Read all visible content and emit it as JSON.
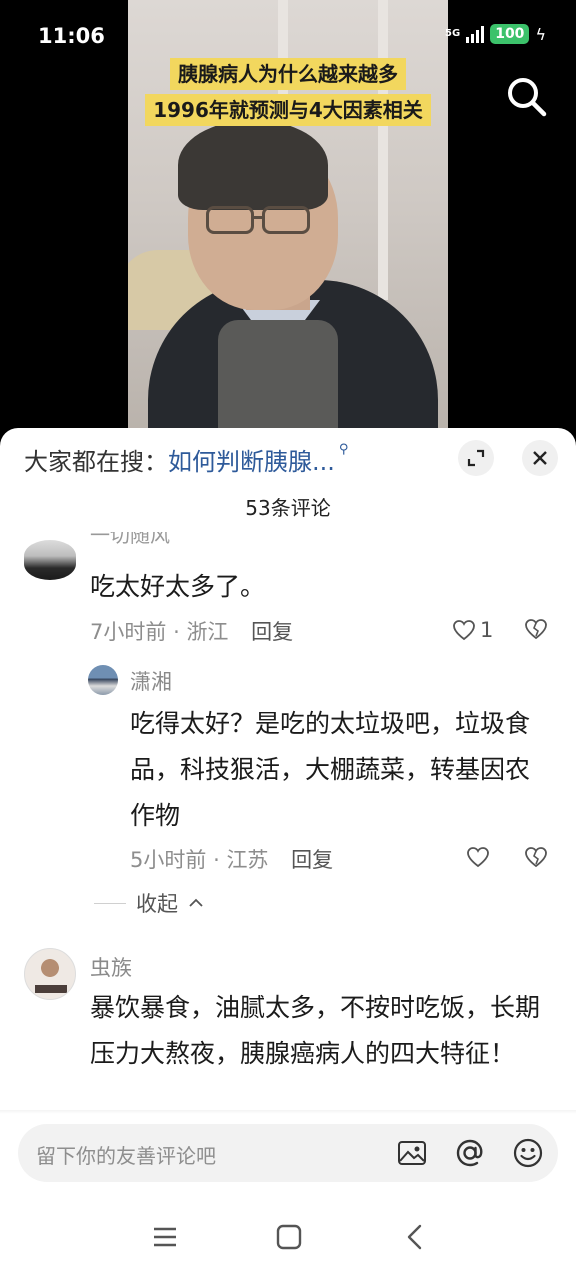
{
  "status_bar": {
    "time": "11:06",
    "network": "5G",
    "battery": "100"
  },
  "video": {
    "caption_line1": "胰腺病人为什么越来越多",
    "caption_line2": "1996年就预测与4大因素相关"
  },
  "sheet": {
    "hot_search_prefix": "大家都在搜：",
    "hot_search_query": "如何判断胰腺...",
    "comment_count": "53条评论",
    "comments": [
      {
        "user": "一切随风",
        "text": "吃太好太多了。",
        "time": "7小时前",
        "location": "浙江",
        "reply_label": "回复",
        "likes": "1"
      },
      {
        "user": "潇湘",
        "text": "吃得太好？是吃的太垃圾吧，垃圾食品，科技狠活，大棚蔬菜，转基因农作物",
        "time": "5小时前",
        "location": "江苏",
        "reply_label": "回复",
        "likes": ""
      },
      {
        "user": "虫族",
        "text": "暴饮暴食，油腻太多，不按时吃饭，长期压力大熬夜，胰腺癌病人的四大特征！"
      }
    ],
    "collapse_label": "收起",
    "meta_separator": "·"
  },
  "input_bar": {
    "placeholder": "留下你的友善评论吧"
  },
  "colors": {
    "caption_bg": "#f2d75e",
    "link": "#2e5a9a",
    "battery": "#3cc26b"
  },
  "icons": [
    "search-icon",
    "expand-icon",
    "close-icon",
    "heart-icon",
    "dislike-icon",
    "image-icon",
    "at-icon",
    "emoji-icon",
    "menu-icon",
    "home-icon",
    "back-icon"
  ]
}
